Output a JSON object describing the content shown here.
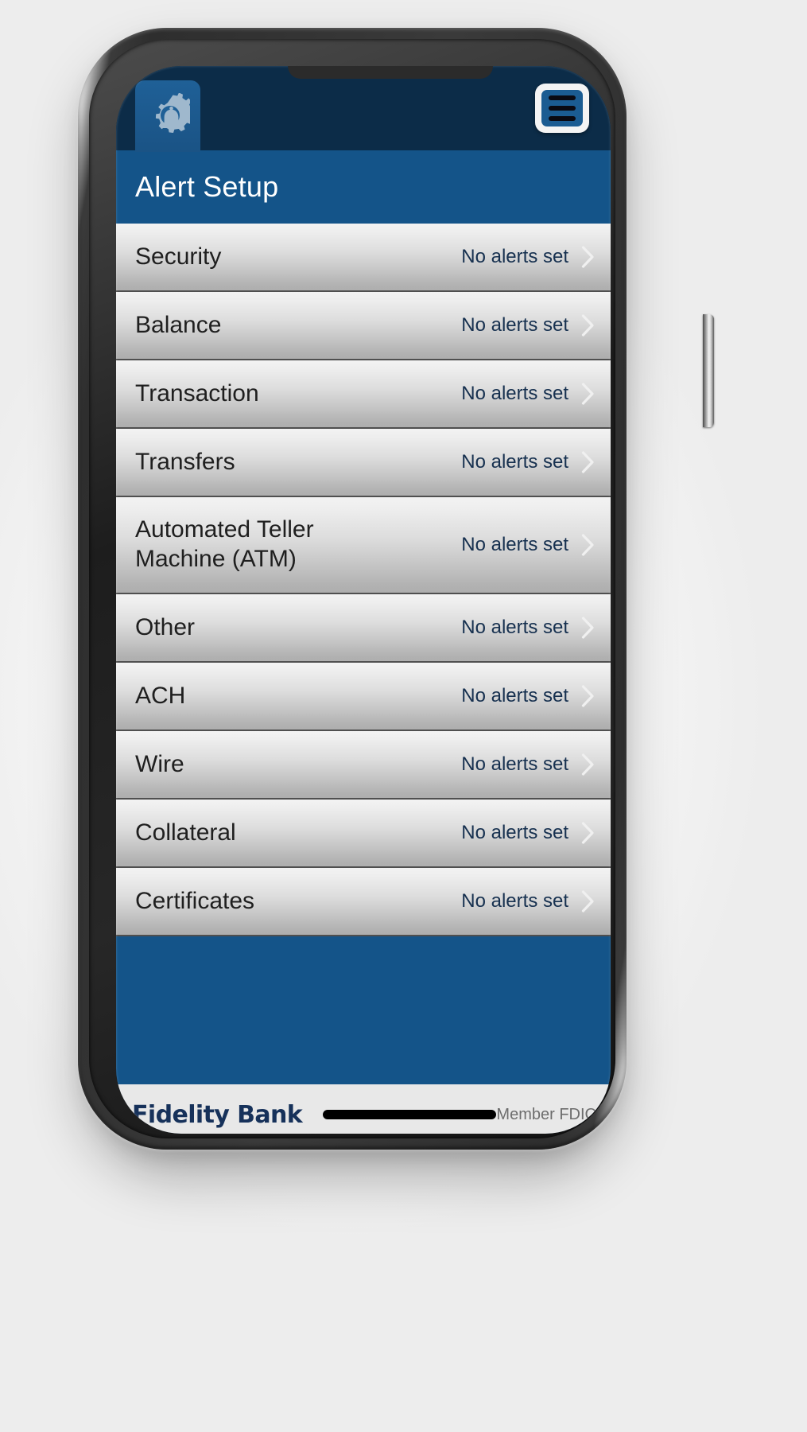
{
  "app": {
    "header": {
      "icon": "bell-gear-icon",
      "menu_icon": "hamburger-menu-icon"
    },
    "title": "Alert Setup"
  },
  "alerts": {
    "default_status": "No alerts set",
    "chevron_icon": "chevron-right-icon",
    "rows": [
      {
        "label": "Security",
        "status": "No alerts set",
        "tall": false
      },
      {
        "label": "Balance",
        "status": "No alerts set",
        "tall": false
      },
      {
        "label": "Transaction",
        "status": "No alerts set",
        "tall": false
      },
      {
        "label": "Transfers",
        "status": "No alerts set",
        "tall": false
      },
      {
        "label": "Automated Teller Machine (ATM)",
        "status": "No alerts set",
        "tall": true
      },
      {
        "label": "Other",
        "status": "No alerts set",
        "tall": false
      },
      {
        "label": "ACH",
        "status": "No alerts set",
        "tall": false
      },
      {
        "label": "Wire",
        "status": "No alerts set",
        "tall": false
      },
      {
        "label": "Collateral",
        "status": "No alerts set",
        "tall": false
      },
      {
        "label": "Certificates",
        "status": "No alerts set",
        "tall": false
      }
    ]
  },
  "footer": {
    "brand": "Fidelity Bank",
    "fdic": "Member FDIC"
  },
  "colors": {
    "header_dark": "#0c2c48",
    "brand_blue": "#145489",
    "icon_tab_blue": "#1f6097",
    "status_text": "#16304f",
    "row_text": "#1f1f1f",
    "brand_navy": "#16315a",
    "footer_bg": "#e8e8e8",
    "fdic_text": "#6d6d6d"
  }
}
